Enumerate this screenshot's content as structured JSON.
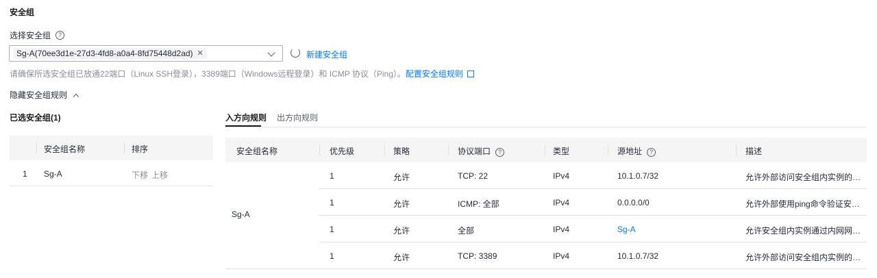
{
  "section_title": "安全组",
  "select_label": "选择安全组",
  "help_glyph": "?",
  "selected_tag": "Sg-A(70ee3d1e-27d3-4fd8-a0a4-8fd75448d2ad)",
  "new_sg_label": "新建安全组",
  "hint_text": "请确保所选安全组已放通22端口（Linux SSH登录），3389端口（Windows远程登录）和 ICMP 协议（Ping）。",
  "hint_link": "配置安全组规则",
  "hide_rules_label": "隐藏安全组规则",
  "selected_groups_title": "已选安全组(1)",
  "tabs": {
    "inbound": "入方向规则",
    "outbound": "出方向规则"
  },
  "left_table": {
    "headers": [
      "安全组名称",
      "排序"
    ],
    "rows": [
      {
        "index": "1",
        "name": "Sg-A",
        "down": "下移",
        "up": "上移"
      }
    ]
  },
  "right_table": {
    "headers": [
      "安全组名称",
      "优先级",
      "策略",
      "协议端口",
      "类型",
      "源地址",
      "描述"
    ],
    "group_name": "Sg-A",
    "rows": [
      {
        "priority": "1",
        "policy": "允许",
        "port": "TCP: 22",
        "type": "IPv4",
        "source": "10.1.0.7/32",
        "desc": "允许外部访问安全组内实例的SS..."
      },
      {
        "priority": "1",
        "policy": "允许",
        "port": "ICMP: 全部",
        "type": "IPv4",
        "source": "0.0.0.0/0",
        "desc": "允许外部使用ping命令验证安全..."
      },
      {
        "priority": "1",
        "policy": "允许",
        "port": "全部",
        "type": "IPv4",
        "source": "Sg-A",
        "desc": "允许安全组内实例通过内网网络..."
      },
      {
        "priority": "1",
        "policy": "允许",
        "port": "TCP: 3389",
        "type": "IPv4",
        "source": "10.1.0.7/32",
        "desc": "允许外部访问安全组内实例的R..."
      }
    ]
  },
  "colors": {
    "link": "#0077ff",
    "text": "#252b3a",
    "muted": "#8a8e99",
    "header_bg": "#f5f5f6"
  }
}
